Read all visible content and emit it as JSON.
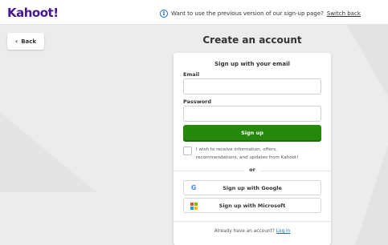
{
  "header": {
    "logo": "Kahoot!",
    "notice_text": "Want to use the previous version of our sign-up page?",
    "switch_link": "Switch back"
  },
  "nav": {
    "back_label": "Back"
  },
  "page": {
    "title": "Create an account"
  },
  "form": {
    "heading": "Sign up with your email",
    "email_label": "Email",
    "email_value": "",
    "password_label": "Password",
    "password_value": "",
    "signup_button": "Sign up",
    "consent_text": "I wish to receive information, offers, recommendations, and updates from Kahoot!",
    "consent_checked": false,
    "or_label": "or",
    "google_button": "Sign up with Google",
    "microsoft_button": "Sign up with Microsoft",
    "account_prompt": "Already have an account?",
    "login_link": "Log in"
  },
  "colors": {
    "brand": "#46178f",
    "primary_button": "#26890c",
    "link": "#1368ce",
    "background": "#ececec"
  },
  "icons": {
    "info": "info-icon",
    "back": "chevron-left-icon",
    "google": "google-icon",
    "microsoft": "microsoft-icon"
  }
}
